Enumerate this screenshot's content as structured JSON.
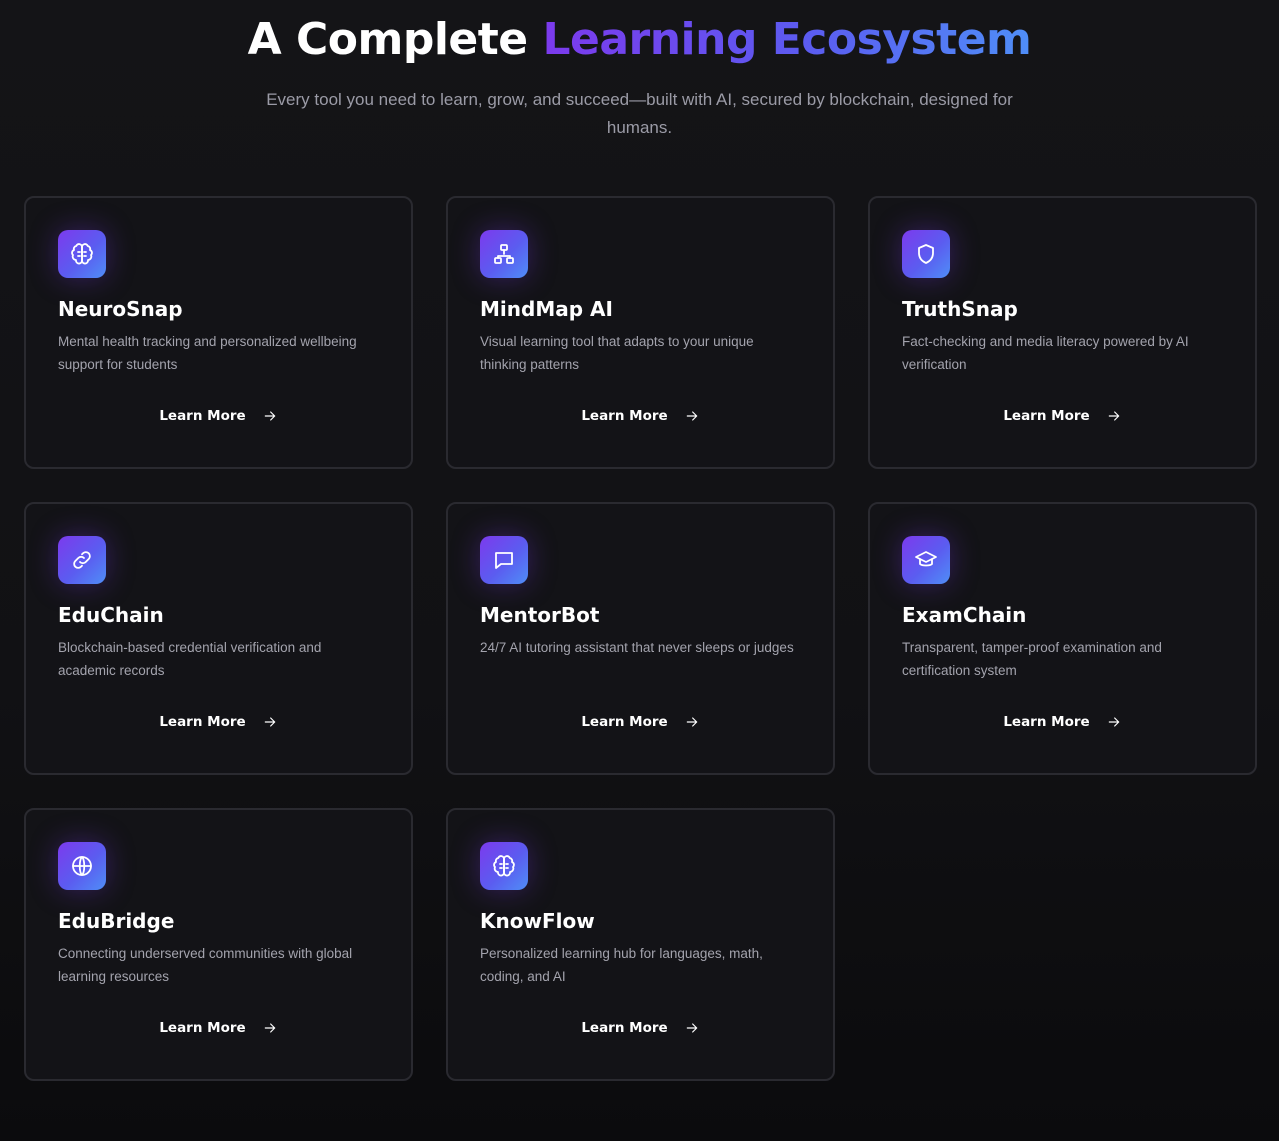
{
  "hero": {
    "title_plain": "A Complete ",
    "title_gradient": "Learning Ecosystem",
    "subtitle": "Every tool you need to learn, grow, and succeed—built with AI, secured by blockchain, designed for humans."
  },
  "colors": {
    "accent_start": "#7c3aed",
    "accent_mid": "#5b5cf0",
    "accent_end": "#4f8ef7",
    "background": "#111114",
    "card_border": "#2a2a30",
    "muted_text": "#a3a3ad"
  },
  "cards": [
    {
      "icon": "brain-icon",
      "title": "NeuroSnap",
      "description": "Mental health tracking and personalized wellbeing support for students",
      "cta": "Learn More"
    },
    {
      "icon": "network-icon",
      "title": "MindMap AI",
      "description": "Visual learning tool that adapts to your unique thinking patterns",
      "cta": "Learn More"
    },
    {
      "icon": "shield-icon",
      "title": "TruthSnap",
      "description": "Fact-checking and media literacy powered by AI verification",
      "cta": "Learn More"
    },
    {
      "icon": "link-icon",
      "title": "EduChain",
      "description": "Blockchain-based credential verification and academic records",
      "cta": "Learn More"
    },
    {
      "icon": "chat-icon",
      "title": "MentorBot",
      "description": "24/7 AI tutoring assistant that never sleeps or judges",
      "cta": "Learn More"
    },
    {
      "icon": "graduation-cap-icon",
      "title": "ExamChain",
      "description": "Transparent, tamper-proof examination and certification system",
      "cta": "Learn More"
    },
    {
      "icon": "globe-icon",
      "title": "EduBridge",
      "description": "Connecting underserved communities with global learning resources",
      "cta": "Learn More"
    },
    {
      "icon": "brain-icon",
      "title": "KnowFlow",
      "description": "Personalized learning hub for languages, math, coding, and AI",
      "cta": "Learn More"
    }
  ]
}
